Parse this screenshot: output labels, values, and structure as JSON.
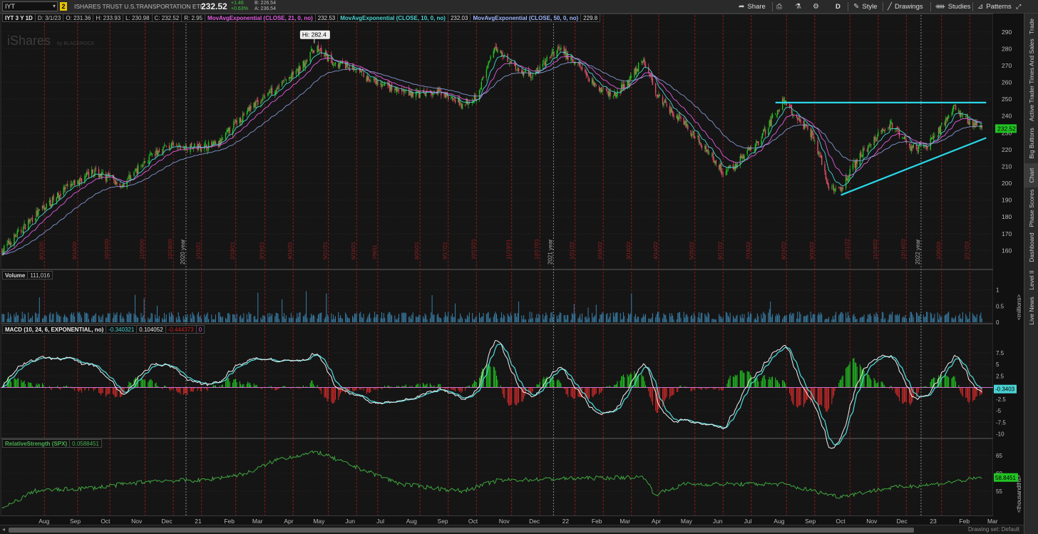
{
  "topbar": {
    "symbol": "IYT",
    "link_badge": "2",
    "description": "ISHARES TRUST U.S.TRANSPORTATION ETF",
    "last": "232.52",
    "change": "+1.46",
    "change_pct": "+0.63%",
    "bid": "B: 226.54",
    "ask": "A: 236.54",
    "buttons": {
      "share": "Share",
      "period": "D",
      "style": "Style",
      "drawings": "Drawings",
      "studies": "Studies",
      "patterns": "Patterns"
    }
  },
  "sidebar": {
    "tabs": [
      "Trade",
      "Times And Sales",
      "Active Trader",
      "Big Buttons",
      "Chart",
      "Phase Scores",
      "Dashboard",
      "Level II",
      "Live News"
    ]
  },
  "price_panel": {
    "header": [
      "IYT 3 Y 1D",
      "D: 3/1/23",
      "O: 231.36",
      "H: 233.93",
      "L: 230.98",
      "C: 232.52",
      "R: 2.95"
    ],
    "studies": [
      {
        "label": "MovAvgExponential (CLOSE, 21, 0, no)",
        "value": "232.53",
        "color": "#e05ce0"
      },
      {
        "label": "MovAvgExponential (CLOSE, 10, 0, no)",
        "value": "232.03",
        "color": "#4ad3d3"
      },
      {
        "label": "MovAvgExponential (CLOSE, 50, 0, no)",
        "value": "229.8",
        "color": "#9fb7ff"
      }
    ],
    "hi_label": "Hi: 282.4",
    "price_tag": "232.52",
    "watermark": "iShares",
    "watermark_by": "by BLACKROCK"
  },
  "volume_panel": {
    "header": [
      "Volume",
      "111,016"
    ],
    "axis_title": "<millions>"
  },
  "macd_panel": {
    "header": [
      "MACD (10, 24, 6, EXPONENTIAL, no)",
      "-0.340321",
      "0.104052",
      "-0.444373",
      "0"
    ],
    "tag": "-0.3403"
  },
  "rs_panel": {
    "header": [
      "RelativeStrength (SPX)",
      "0.0588451"
    ],
    "tag": "58.8451",
    "axis_title": "<thousandths>"
  },
  "bottombar": {
    "drawing_set": "Drawing set: Default"
  },
  "chart_data": {
    "type": "candlestick",
    "x_range": [
      "2020-07",
      "2023-03"
    ],
    "x_labels": [
      "Aug",
      "Sep",
      "Oct",
      "Nov",
      "Dec",
      "21",
      "Feb",
      "Mar",
      "Apr",
      "May",
      "Jun",
      "Jul",
      "Aug",
      "Sep",
      "Oct",
      "Nov",
      "Dec",
      "22",
      "Feb",
      "Mar",
      "Apr",
      "May",
      "Jun",
      "Jul",
      "Aug",
      "Sep",
      "Oct",
      "Nov",
      "Dec",
      "23",
      "Feb",
      "Mar"
    ],
    "year_labels": [
      "2020 year",
      "2021 year",
      "2022 year"
    ],
    "event_labels": [
      "8/12/20",
      "9/14/20",
      "10/16/20",
      "11/20/20",
      "12/18/20",
      "1/15/21",
      "2/18/21",
      "3/19/21",
      "4/16/21",
      "5/21/21",
      "6/18/21",
      "7/9/21",
      "8/20/21",
      "9/17/21",
      "10/15/21",
      "11/19/21",
      "12/17/21",
      "1/21/22",
      "2/18/22",
      "3/18/22",
      "4/14/22",
      "5/20/22",
      "6/17/22",
      "7/15/22",
      "8/19/22",
      "9/16/22",
      "10/21/22",
      "11/18/22",
      "12/16/22",
      "1/20/23",
      "2/17/23"
    ],
    "price_axis": {
      "min": 150,
      "max": 295,
      "ticks": [
        160,
        170,
        180,
        190,
        200,
        210,
        220,
        230,
        240,
        250,
        260,
        270,
        280,
        290
      ]
    },
    "price_path": [
      [
        "2020-07-01",
        160
      ],
      [
        "2020-08-01",
        180
      ],
      [
        "2020-09-01",
        196
      ],
      [
        "2020-10-01",
        207
      ],
      [
        "2020-10-28",
        199
      ],
      [
        "2020-11-20",
        213
      ],
      [
        "2020-12-10",
        222
      ],
      [
        "2021-01-01",
        221
      ],
      [
        "2021-02-01",
        223
      ],
      [
        "2021-02-15",
        234
      ],
      [
        "2021-03-10",
        248
      ],
      [
        "2021-04-01",
        258
      ],
      [
        "2021-04-20",
        266
      ],
      [
        "2021-05-08",
        281
      ],
      [
        "2021-05-25",
        272
      ],
      [
        "2021-06-15",
        268
      ],
      [
        "2021-07-05",
        260
      ],
      [
        "2021-07-28",
        255
      ],
      [
        "2021-08-20",
        253
      ],
      [
        "2021-09-10",
        254
      ],
      [
        "2021-09-30",
        247
      ],
      [
        "2021-10-15",
        252
      ],
      [
        "2021-11-03",
        281
      ],
      [
        "2021-11-25",
        268
      ],
      [
        "2021-12-10",
        264
      ],
      [
        "2022-01-04",
        280
      ],
      [
        "2022-01-25",
        270
      ],
      [
        "2022-02-10",
        258
      ],
      [
        "2022-02-28",
        252
      ],
      [
        "2022-03-15",
        260
      ],
      [
        "2022-03-29",
        274
      ],
      [
        "2022-04-15",
        250
      ],
      [
        "2022-05-05",
        238
      ],
      [
        "2022-05-25",
        225
      ],
      [
        "2022-06-17",
        207
      ],
      [
        "2022-07-01",
        212
      ],
      [
        "2022-07-22",
        225
      ],
      [
        "2022-08-16",
        249
      ],
      [
        "2022-09-01",
        237
      ],
      [
        "2022-09-15",
        228
      ],
      [
        "2022-09-30",
        198
      ],
      [
        "2022-10-12",
        197
      ],
      [
        "2022-11-01",
        218
      ],
      [
        "2022-11-30",
        235
      ],
      [
        "2022-12-20",
        222
      ],
      [
        "2023-01-05",
        221
      ],
      [
        "2023-01-25",
        238
      ],
      [
        "2023-02-02",
        246
      ],
      [
        "2023-02-17",
        236
      ],
      [
        "2023-03-01",
        232.52
      ]
    ],
    "resistance_line": {
      "from": [
        "2022-08-08",
        248
      ],
      "to": [
        "2023-03-01",
        248
      ]
    },
    "support_line": {
      "from": [
        "2022-10-12",
        193
      ],
      "to": [
        "2023-03-01",
        227
      ]
    },
    "hi_point": [
      "2021-05-07",
      282.4
    ],
    "volume_axis": {
      "ticks": [
        0,
        0.5,
        1
      ],
      "unit": "millions"
    },
    "macd_axis": {
      "ticks": [
        -10,
        -7.5,
        -5,
        -2.5,
        0,
        2.5,
        5,
        7.5
      ]
    },
    "rs_axis": {
      "ticks": [
        55,
        60,
        65
      ]
    },
    "rs_path": [
      [
        "2020-07-01",
        50
      ],
      [
        "2020-08-01",
        55
      ],
      [
        "2020-10-01",
        56
      ],
      [
        "2020-12-01",
        58
      ],
      [
        "2021-01-15",
        58
      ],
      [
        "2021-03-01",
        60
      ],
      [
        "2021-04-01",
        64
      ],
      [
        "2021-05-10",
        66
      ],
      [
        "2021-06-15",
        62
      ],
      [
        "2021-08-01",
        57
      ],
      [
        "2021-10-01",
        55
      ],
      [
        "2021-11-05",
        58
      ],
      [
        "2022-01-05",
        58.5
      ],
      [
        "2022-03-31",
        59
      ],
      [
        "2022-04-10",
        54
      ],
      [
        "2022-05-10",
        57
      ],
      [
        "2022-07-01",
        57
      ],
      [
        "2022-08-15",
        57
      ],
      [
        "2022-10-10",
        53.5
      ],
      [
        "2022-12-01",
        56
      ],
      [
        "2023-01-15",
        57
      ],
      [
        "2023-03-01",
        58.8
      ]
    ]
  }
}
